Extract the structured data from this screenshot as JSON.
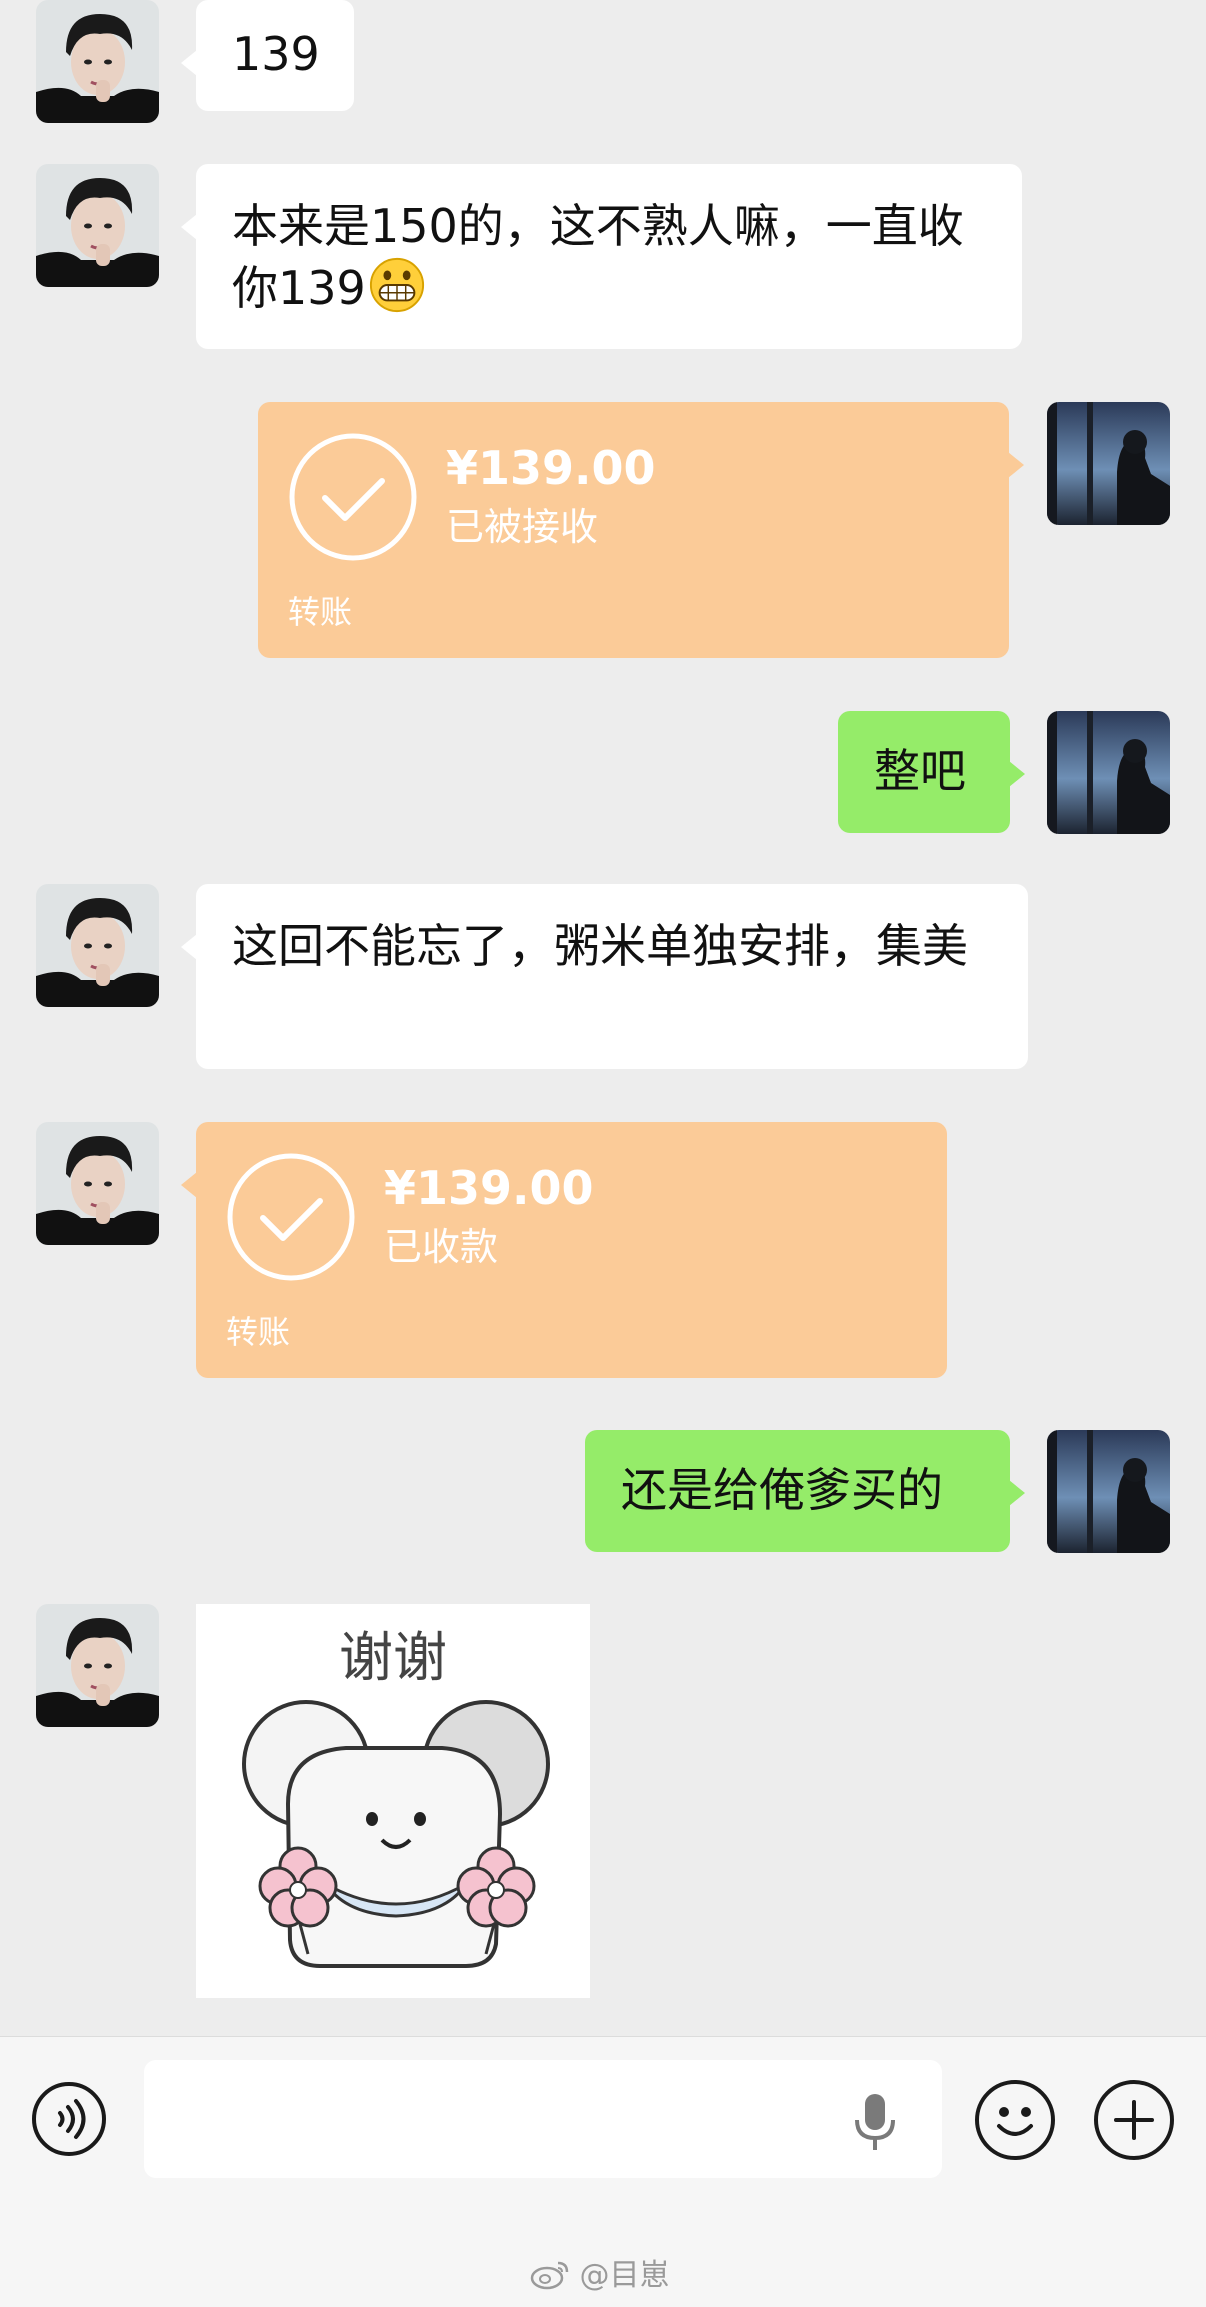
{
  "conversation": {
    "messages": [
      {
        "id": "m1",
        "side": "left",
        "text": "139"
      },
      {
        "id": "m2",
        "side": "left",
        "text": "本来是150的，这不熟人嘛，一直收你139",
        "emoji": "grinning-face-emoji"
      },
      {
        "id": "m3",
        "side": "right",
        "type": "transfer",
        "amount": "¥139.00",
        "status": "已被接收",
        "label": "转账"
      },
      {
        "id": "m4",
        "side": "right",
        "text": "整吧"
      },
      {
        "id": "m5",
        "side": "left",
        "text": "这回不能忘了，粥米单独安排，集美"
      },
      {
        "id": "m6",
        "side": "left",
        "type": "transfer",
        "amount": "¥139.00",
        "status": "已收款",
        "label": "转账"
      },
      {
        "id": "m7",
        "side": "right",
        "text": "还是给俺爹买的"
      },
      {
        "id": "m8",
        "side": "left",
        "type": "sticker",
        "sticker_text": "谢谢",
        "sticker_icon": "mouse-with-flowers-sticker"
      }
    ]
  },
  "input_bar": {
    "voice_icon": "voice-mode-icon",
    "placeholder": "",
    "mic_icon": "microphone-icon",
    "emoji_icon": "smiley-icon",
    "plus_icon": "plus-icon"
  },
  "watermark": {
    "text": "@目崽",
    "icon": "weibo-logo-icon"
  },
  "colors": {
    "background": "#ededed",
    "incoming_bubble": "#ffffff",
    "outgoing_bubble": "#95ec69",
    "transfer_card": "#fbcb98"
  }
}
